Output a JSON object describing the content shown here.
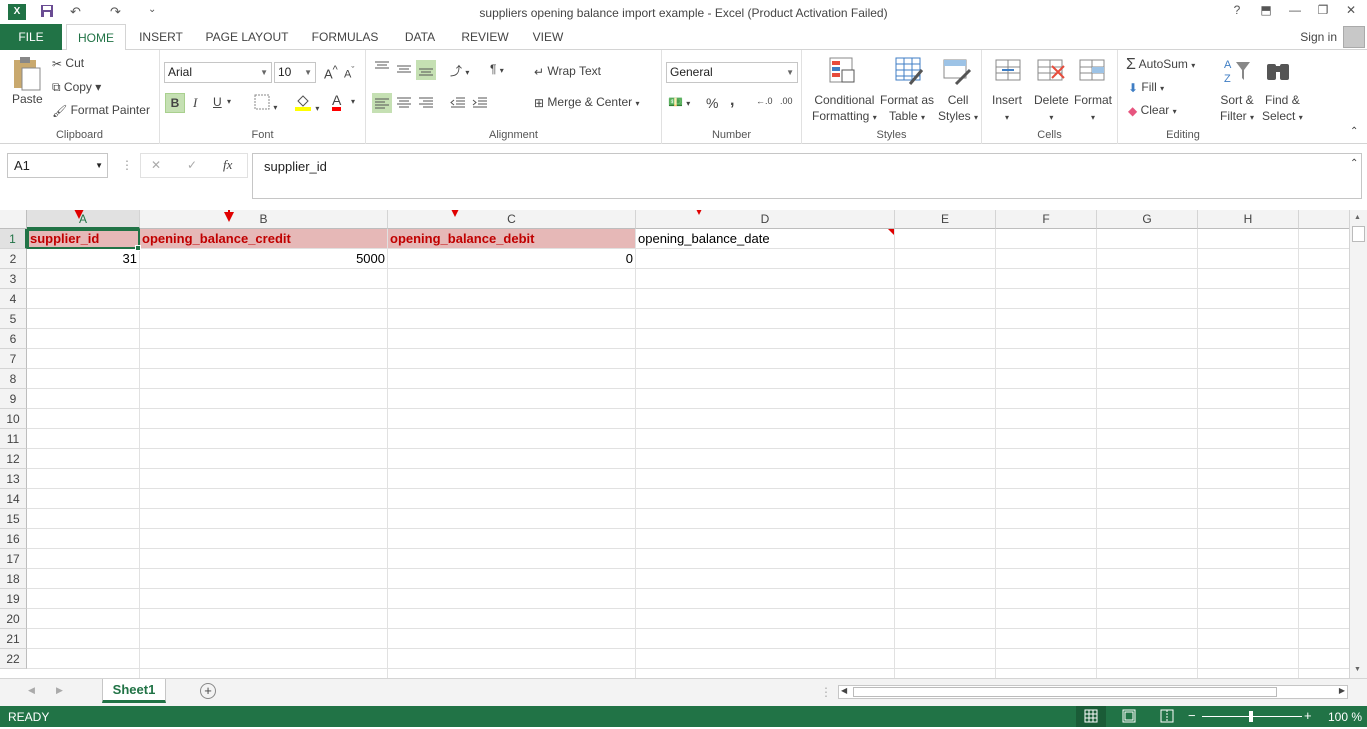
{
  "window": {
    "title": "suppliers opening balance import example - Excel (Product Activation Failed)",
    "help": "?",
    "restore_ribbon": "⬒",
    "minimize": "—",
    "maximize": "❐",
    "close": "✕"
  },
  "qat": {
    "logo": "X",
    "save": "💾",
    "undo": "↶",
    "redo": "↷",
    "customize": "⌄"
  },
  "tabs": [
    "FILE",
    "HOME",
    "INSERT",
    "PAGE LAYOUT",
    "FORMULAS",
    "DATA",
    "REVIEW",
    "VIEW"
  ],
  "sign_in": "Sign in",
  "clipboard": {
    "paste": "Paste",
    "cut": "Cut",
    "copy": "Copy",
    "format_painter": "Format Painter",
    "label": "Clipboard"
  },
  "font": {
    "name": "Arial",
    "size": "10",
    "bold": "B",
    "italic": "I",
    "underline": "U",
    "grow": "A",
    "shrink": "A",
    "color_letter": "A",
    "label": "Font"
  },
  "alignment": {
    "wrap_text": "Wrap Text",
    "merge_center": "Merge & Center",
    "label": "Alignment"
  },
  "number": {
    "format": "General",
    "percent": "%",
    "comma": ",",
    "inc": "←.0",
    "dec": ".00",
    "label": "Number"
  },
  "styles": {
    "conditional": "Conditional",
    "conditional2": "Formatting",
    "format_as": "Format as",
    "format_as2": "Table",
    "cell": "Cell",
    "cell2": "Styles",
    "label": "Styles"
  },
  "cells": {
    "insert": "Insert",
    "delete": "Delete",
    "format": "Format",
    "label": "Cells"
  },
  "editing": {
    "autosum": "AutoSum",
    "fill": "Fill",
    "clear": "Clear",
    "sort": "Sort &",
    "sort2": "Filter",
    "find": "Find &",
    "find2": "Select",
    "label": "Editing"
  },
  "formula_bar": {
    "name_box": "A1",
    "cancel": "✕",
    "enter": "✓",
    "fx": "fx",
    "content": "supplier_id"
  },
  "columns": [
    "A",
    "B",
    "C",
    "D",
    "E",
    "F",
    "G",
    "H"
  ],
  "rows": [
    "1",
    "2",
    "3",
    "4",
    "5",
    "6",
    "7",
    "8",
    "9",
    "10",
    "11",
    "12",
    "13",
    "14",
    "15",
    "16",
    "17",
    "18",
    "19",
    "20",
    "21",
    "22"
  ],
  "cells_data": {
    "a1": "supplier_id",
    "b1": "opening_balance_credit",
    "c1": "opening_balance_debit",
    "d1": "opening_balance_date",
    "a2": "31",
    "b2": "5000",
    "c2": "0"
  },
  "sheet": {
    "tab": "Sheet1",
    "add": "+"
  },
  "status": {
    "ready": "READY",
    "zoom": "100 %",
    "minus": "−",
    "plus": "+"
  },
  "colors": {
    "accent": "#217346",
    "header_fill": "#e6b8b7",
    "header_text": "#c00000",
    "arrow": "#e00000"
  }
}
